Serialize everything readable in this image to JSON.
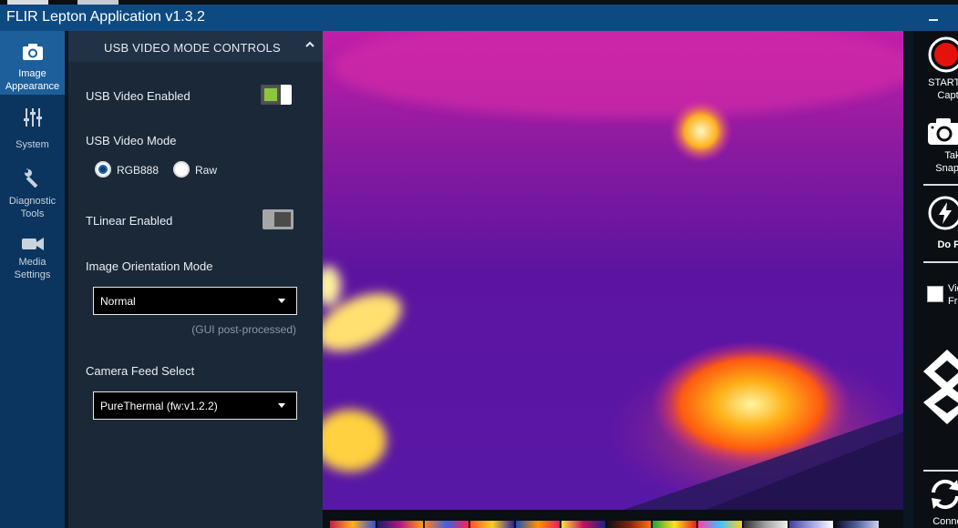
{
  "app": {
    "title": "FLIR Lepton Application v1.3.2"
  },
  "nav": {
    "items": [
      {
        "label_line1": "Image",
        "label_line2": "Appearance",
        "icon": "camera-icon",
        "active": true
      },
      {
        "label_line1": "System",
        "label_line2": "",
        "icon": "sliders-icon",
        "active": false
      },
      {
        "label_line1": "Diagnostic",
        "label_line2": "Tools",
        "icon": "wrench-icon",
        "active": false
      },
      {
        "label_line1": "Media",
        "label_line2": "Settings",
        "icon": "video-camera-icon",
        "active": false
      }
    ]
  },
  "panel": {
    "header": "USB VIDEO MODE CONTROLS",
    "usb_video_enabled": {
      "label": "USB Video Enabled",
      "on": true
    },
    "usb_video_mode": {
      "label": "USB Video Mode",
      "options": [
        "RGB888",
        "Raw"
      ],
      "selected": "RGB888"
    },
    "tlinear": {
      "label": "TLinear Enabled",
      "on": false
    },
    "orientation": {
      "label": "Image Orientation Mode",
      "value": "Normal",
      "note": "(GUI post-processed)"
    },
    "camera_feed": {
      "label": "Camera Feed Select",
      "value": "PureThermal (fw:v1.2.2)"
    }
  },
  "right": {
    "record_line1": "START Vide",
    "record_line2": "Capture",
    "snapshot_line1": "Take",
    "snapshot_line2": "Snapsho",
    "ffc_label": "Do FFC",
    "freeze_line1": "Vide",
    "freeze_line2": "Freez",
    "connection_label": "Connectio"
  },
  "colors": {
    "titlebar": "#0e4a82",
    "nav_bg": "#0b355f",
    "nav_active": "#1d5f9a",
    "panel_bg": "#1b2838",
    "toggle_on": "#8cc63f",
    "record_red": "#e3120b"
  }
}
